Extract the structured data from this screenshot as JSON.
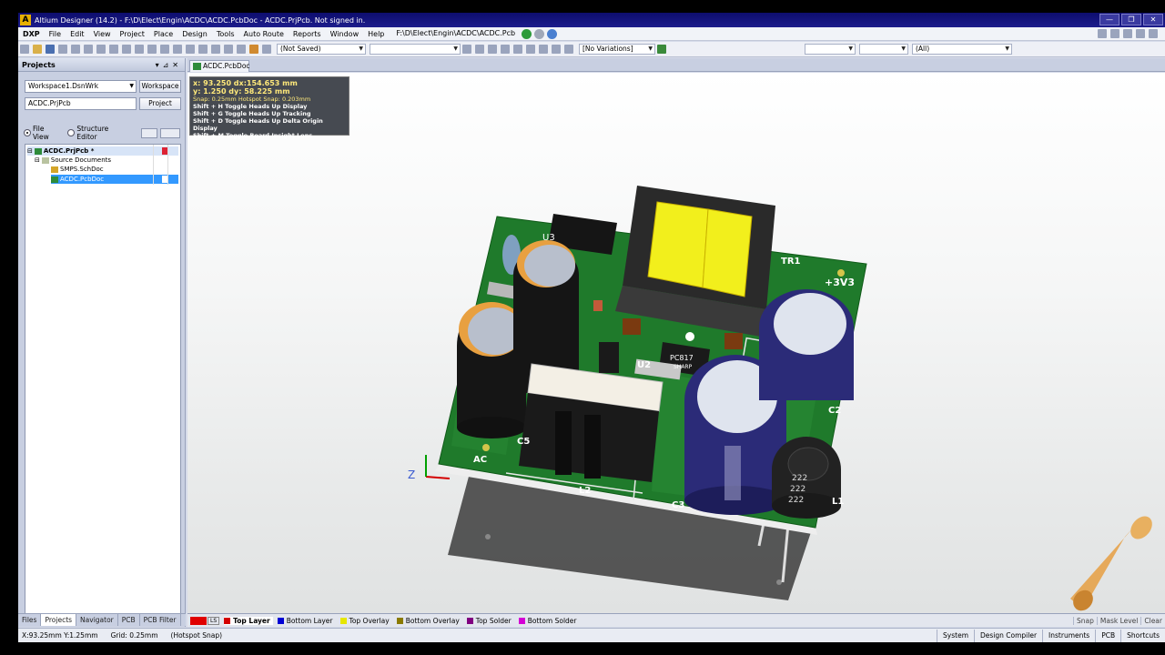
{
  "titlebar": {
    "title": "Altium Designer (14.2) - F:\\D\\Elect\\Engin\\ACDC\\ACDC.PcbDoc - ACDC.PrjPcb. Not signed in."
  },
  "menu": {
    "items": [
      "DXP",
      "File",
      "Edit",
      "View",
      "Project",
      "Place",
      "Design",
      "Tools",
      "Auto Route",
      "Reports",
      "Window",
      "Help"
    ],
    "path": "F:\\D\\Elect\\Engin\\ACDC\\ACDC.Pcb"
  },
  "toolbar": {
    "saved_combo": "(Not Saved)",
    "variations_combo": "[No Variations]",
    "filter_combo": "(All)"
  },
  "projects_panel": {
    "title": "Projects",
    "workspace_value": "Workspace1.DsnWrk",
    "workspace_button": "Workspace",
    "project_value": "ACDC.PrjPcb",
    "project_button": "Project",
    "file_view": "File View",
    "structure_editor": "Structure Editor",
    "tree": {
      "project": "ACDC.PrjPcb *",
      "folder": "Source Documents",
      "sch": "SMPS.SchDoc",
      "pcb": "ACDC.PcbDoc"
    }
  },
  "panel_tabs": [
    "Files",
    "Projects",
    "Navigator",
    "PCB",
    "PCB Filter"
  ],
  "doc_tab": "ACDC.PcbDoc",
  "hud": {
    "line1": "x: 93.250   dx:154.653  mm",
    "line2": "y:  1.250   dy: 58.225  mm",
    "snap": "Snap: 0.25mm Hotspot Snap: 0.203mm",
    "shortcuts": [
      "Shift + H   Toggle Heads Up Display",
      "Shift + G   Toggle Heads Up Tracking",
      "Shift + D   Toggle Heads Up Delta Origin Display",
      "Shift + M  Toggle Board Insight Lens"
    ]
  },
  "board": {
    "labels": [
      "U3",
      "TR1",
      "+3V3",
      "U2",
      "C5",
      "L2",
      "C3",
      "L1",
      "C2",
      "AC",
      "PC817",
      "SHARP",
      "222",
      "222",
      "222"
    ]
  },
  "layers": {
    "ls": "LS",
    "items": [
      {
        "name": "Top Layer",
        "color": "#d40000"
      },
      {
        "name": "Bottom Layer",
        "color": "#0000d4"
      },
      {
        "name": "Top Overlay",
        "color": "#e6e600"
      },
      {
        "name": "Bottom Overlay",
        "color": "#8a7a00"
      },
      {
        "name": "Top Solder",
        "color": "#800080"
      },
      {
        "name": "Bottom Solder",
        "color": "#d400d4"
      }
    ],
    "right": [
      "Snap",
      "Mask Level",
      "Clear"
    ]
  },
  "statusbar": {
    "coords": "X:93.25mm Y:1.25mm",
    "grid": "Grid: 0.25mm",
    "snap": "(Hotspot Snap)",
    "right": [
      "System",
      "Design Compiler",
      "Instruments",
      "PCB",
      "Shortcuts"
    ]
  }
}
